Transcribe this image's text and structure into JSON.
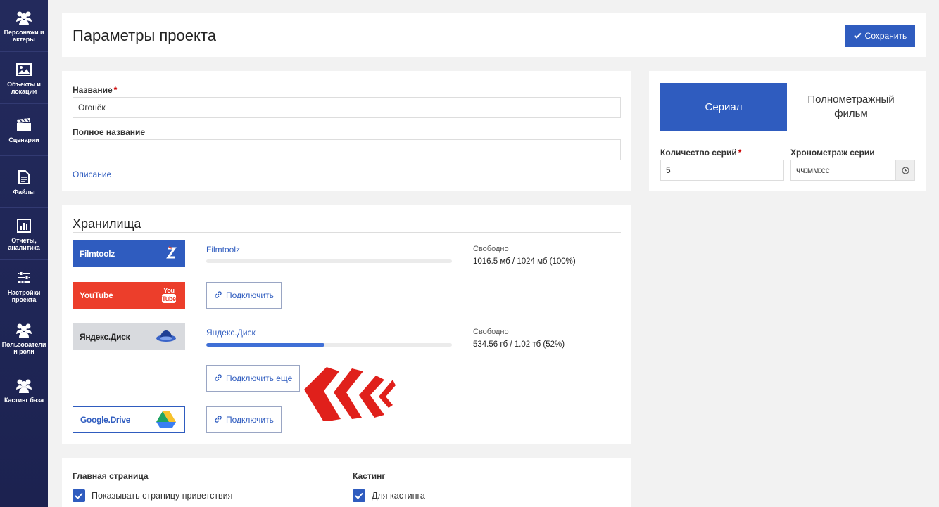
{
  "sidebar": {
    "items": [
      {
        "label": "Персонажи и актеры",
        "icon": "users-icon"
      },
      {
        "label": "Объекты и локации",
        "icon": "image-icon"
      },
      {
        "label": "Сценарии",
        "icon": "clapperboard-icon"
      },
      {
        "label": "Файлы",
        "icon": "file-icon"
      },
      {
        "label": "Отчеты, аналитика",
        "icon": "chart-icon"
      },
      {
        "label": "Настройки проекта",
        "icon": "sliders-icon"
      },
      {
        "label": "Пользователи и роли",
        "icon": "users-icon"
      },
      {
        "label": "Кастинг база",
        "icon": "users-icon"
      }
    ]
  },
  "header": {
    "title": "Параметры проекта",
    "save_label": "Сохранить"
  },
  "project": {
    "name_label": "Название",
    "name_value": "Огонёк",
    "fullname_label": "Полное название",
    "fullname_value": "",
    "description_link": "Описание"
  },
  "project_type": {
    "tab_serial": "Сериал",
    "tab_film": "Полнометражный фильм",
    "episodes_label": "Количество серий",
    "episodes_value": "5",
    "duration_label": "Хронометраж серии",
    "duration_placeholder": "чч:мм:сс"
  },
  "storage": {
    "title": "Хранилища",
    "filmtoolz": {
      "logo": "Filmtoolz",
      "name": "Filmtoolz",
      "free_label": "Свободно",
      "free_value": "1016.5 мб / 1024 мб (100%)",
      "used_fraction": 0.0
    },
    "youtube": {
      "logo": "YouTube",
      "connect": "Подключить"
    },
    "yandex": {
      "logo": "Яндекс.Диск",
      "name": "Яндекс.Диск",
      "free_label": "Свободно",
      "free_value": "534.56 гб / 1.02 тб (52%)",
      "used_fraction": 0.48,
      "connect_more": "Подключить еще"
    },
    "gdrive": {
      "logo": "Google.Drive",
      "connect": "Подключить"
    }
  },
  "bottom": {
    "home_title": "Главная страница",
    "home_check": "Показывать страницу приветствия",
    "casting_title": "Кастинг",
    "casting_check": "Для кастинга"
  },
  "colors": {
    "accent": "#2f5cbf",
    "sidebar": "#232a5c",
    "youtube": "#ec3e2b",
    "annotation_arrow": "#e0201b"
  }
}
